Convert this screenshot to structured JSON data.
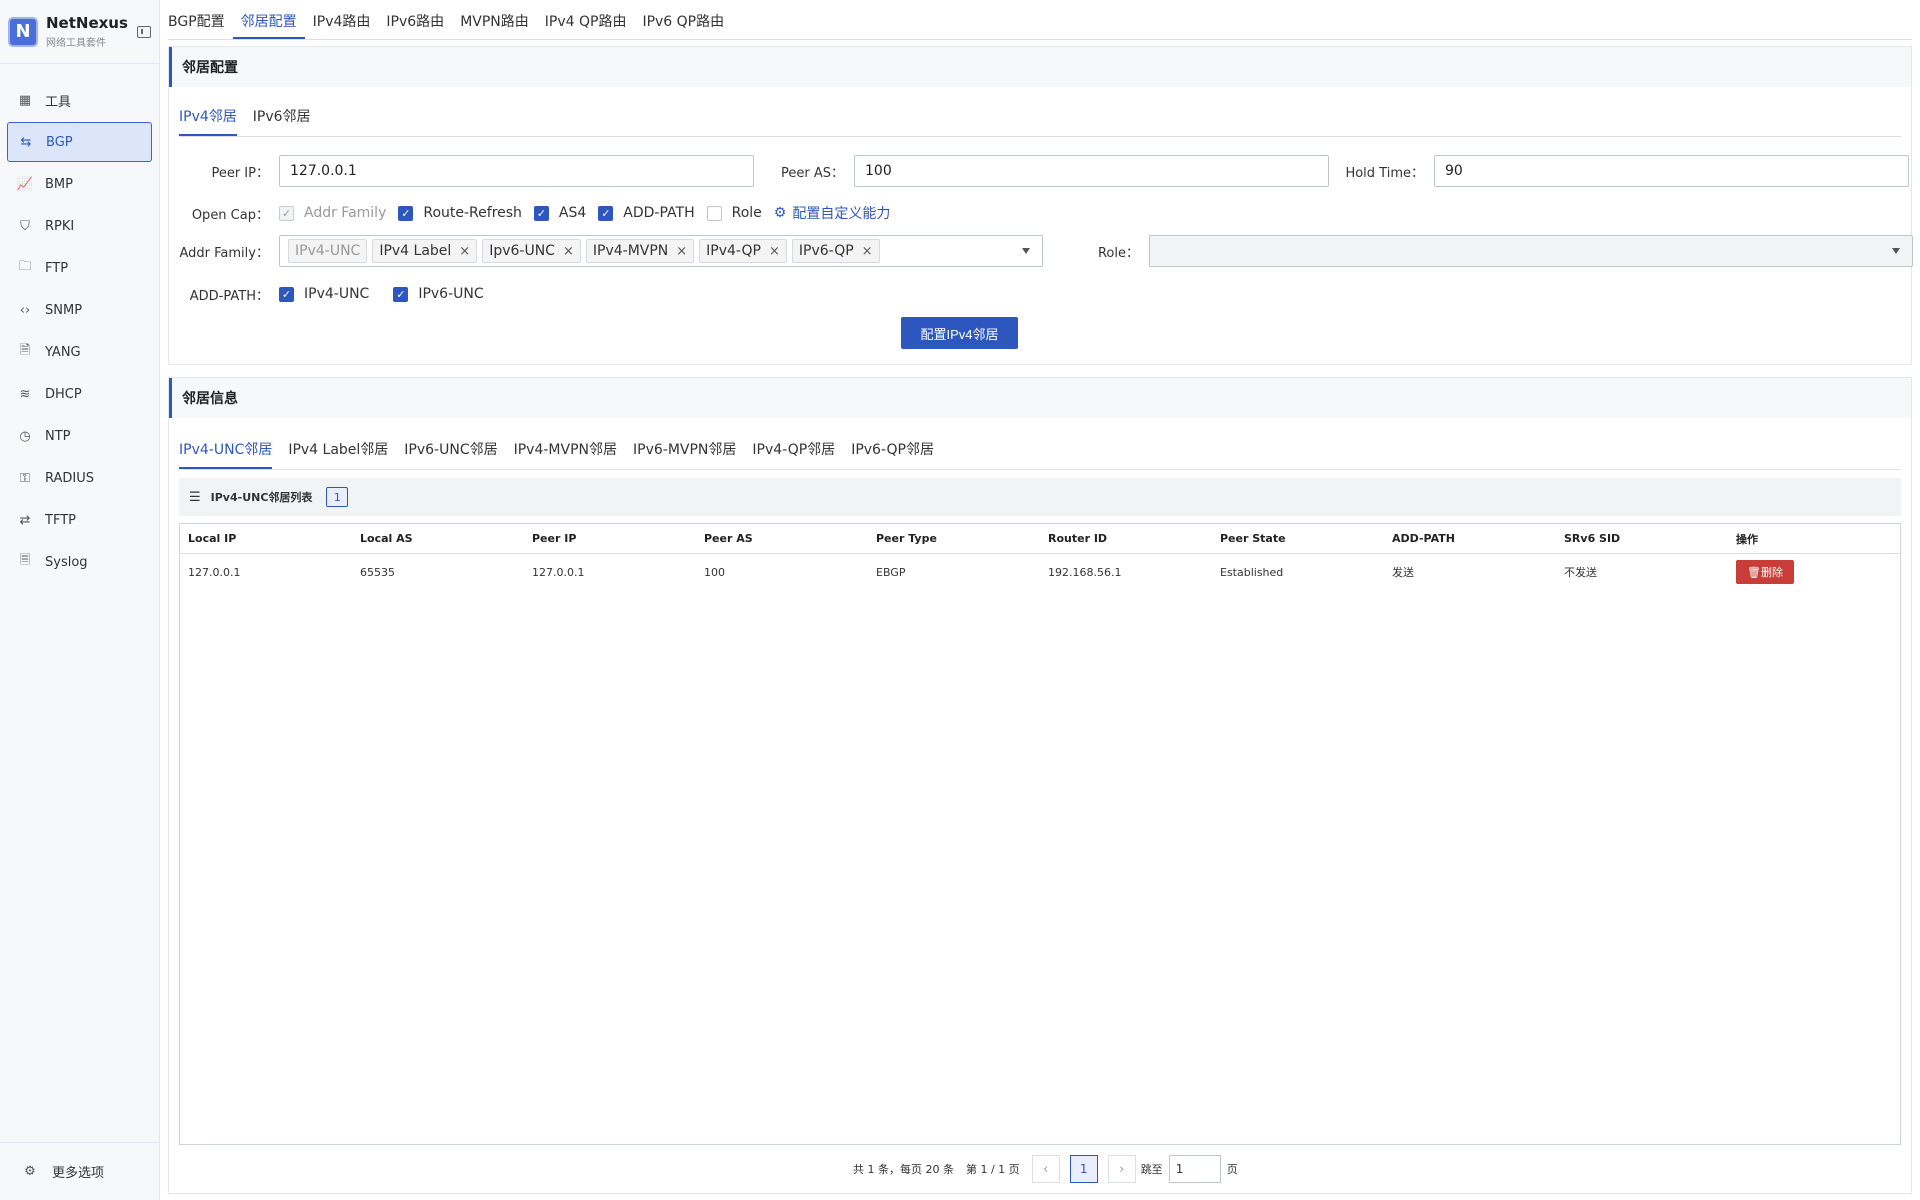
{
  "app": {
    "name": "NetNexus",
    "subtitle": "网络工具套件",
    "logo_letter": "N"
  },
  "sidebar": {
    "items": [
      {
        "label": "工具",
        "icon": "grid-icon"
      },
      {
        "label": "BGP",
        "icon": "route-icon",
        "active": true
      },
      {
        "label": "BMP",
        "icon": "chart-icon"
      },
      {
        "label": "RPKI",
        "icon": "shield-icon"
      },
      {
        "label": "FTP",
        "icon": "folder-icon"
      },
      {
        "label": "SNMP",
        "icon": "code-icon"
      },
      {
        "label": "YANG",
        "icon": "file-icon"
      },
      {
        "label": "DHCP",
        "icon": "wifi-icon"
      },
      {
        "label": "NTP",
        "icon": "clock-icon"
      },
      {
        "label": "RADIUS",
        "icon": "key-icon"
      },
      {
        "label": "TFTP",
        "icon": "transfer-icon"
      },
      {
        "label": "Syslog",
        "icon": "file-text-icon"
      }
    ],
    "footer_label": "更多选项"
  },
  "top_tabs": [
    "BGP配置",
    "邻居配置",
    "IPv4路由",
    "IPv6路由",
    "MVPN路由",
    "IPv4 QP路由",
    "IPv6 QP路由"
  ],
  "top_tabs_active": 1,
  "config_panel": {
    "title": "邻居配置",
    "tabs": [
      "IPv4邻居",
      "IPv6邻居"
    ],
    "peer_ip_label": "Peer IP",
    "peer_ip": "127.0.0.1",
    "peer_as_label": "Peer AS",
    "peer_as": "100",
    "hold_time_label": "Hold Time",
    "hold_time": "90",
    "open_cap_label": "Open Cap",
    "open_cap": [
      {
        "label": "Addr Family",
        "checked": true,
        "disabled": true
      },
      {
        "label": "Route-Refresh",
        "checked": true
      },
      {
        "label": "AS4",
        "checked": true
      },
      {
        "label": "ADD-PATH",
        "checked": true
      },
      {
        "label": "Role",
        "checked": false
      }
    ],
    "custom_cap_link": "配置自定义能力",
    "addr_family_label": "Addr Family",
    "addr_family_tags": [
      {
        "label": "IPv4-UNC",
        "disabled": true
      },
      {
        "label": "IPv4 Label"
      },
      {
        "label": "Ipv6-UNC"
      },
      {
        "label": "IPv4-MVPN"
      },
      {
        "label": "IPv4-QP"
      },
      {
        "label": "IPv6-QP"
      }
    ],
    "role_label": "Role",
    "role_value": "",
    "add_path_label": "ADD-PATH",
    "add_path": [
      {
        "label": "IPv4-UNC",
        "checked": true
      },
      {
        "label": "IPv6-UNC",
        "checked": true
      }
    ],
    "submit_label": "配置IPv4邻居"
  },
  "info_panel": {
    "title": "邻居信息",
    "tabs": [
      "IPv4-UNC邻居",
      "IPv4 Label邻居",
      "IPv6-UNC邻居",
      "IPv4-MVPN邻居",
      "IPv6-MVPN邻居",
      "IPv4-QP邻居",
      "IPv6-QP邻居"
    ],
    "list_title": "IPv4-UNC邻居列表",
    "count": "1",
    "columns": [
      "Local IP",
      "Local AS",
      "Peer IP",
      "Peer AS",
      "Peer Type",
      "Router ID",
      "Peer State",
      "ADD-PATH",
      "SRv6 SID",
      "操作"
    ],
    "rows": [
      [
        "127.0.0.1",
        "65535",
        "127.0.0.1",
        "100",
        "EBGP",
        "192.168.56.1",
        "Established",
        "发送",
        "不发送"
      ]
    ],
    "delete_label": "删除"
  },
  "pagination": {
    "summary": "共 1 条，每页 20 条",
    "page_info": "第 1 / 1 页",
    "current": "1",
    "jump_label": "跳至",
    "jump_value": "1",
    "page_suffix": "页"
  },
  "colors": {
    "accent": "#2d57bf",
    "danger": "#c93d38"
  }
}
